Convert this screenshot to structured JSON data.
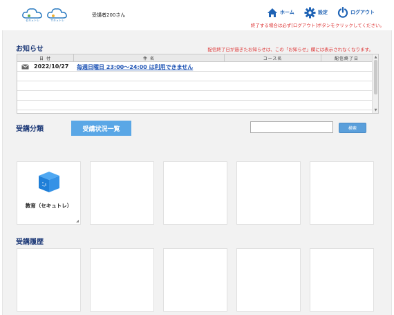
{
  "header": {
    "logos": [
      {
        "name": "securitrain-logo",
        "label": "セキュトレ"
      },
      {
        "name": "second-logo",
        "label": "サキュトレ"
      }
    ],
    "username": "受講者200さん",
    "nav": {
      "home": "ホーム",
      "settings": "設定",
      "logout": "ログアウト"
    },
    "logout_note": "終了する場合は必ず[ログアウト]ボタンをクリックしてください。"
  },
  "news": {
    "title": "お知らせ",
    "note": "配信終了日が過ぎたお知らせは、この「お知らせ」欄には表示されなくなります。",
    "columns": [
      "日 付",
      "件 名",
      "コース名",
      "配信終了日"
    ],
    "rows": [
      {
        "date": "2022/10/27",
        "title": "毎週日曜日 23:00～24:00 は利用できません",
        "course": "",
        "end_date": ""
      }
    ]
  },
  "categories": {
    "title": "受講分類",
    "status_button": "受講状況一覧",
    "search": {
      "value": "",
      "placeholder": "",
      "button": "検索"
    },
    "cards": [
      {
        "label": "教育（セキュトレ）",
        "icon": "cube-icon"
      },
      {
        "label": ""
      },
      {
        "label": ""
      },
      {
        "label": ""
      },
      {
        "label": ""
      }
    ]
  },
  "history": {
    "title": "受講履歴",
    "cards": [
      {
        "label": ""
      },
      {
        "label": ""
      },
      {
        "label": ""
      },
      {
        "label": ""
      },
      {
        "label": ""
      }
    ]
  },
  "colors": {
    "accent": "#5aa7e6",
    "nav": "#1f63b5",
    "title": "#1e3a78",
    "warning": "#dd3333",
    "background": "#f2f2f2"
  }
}
